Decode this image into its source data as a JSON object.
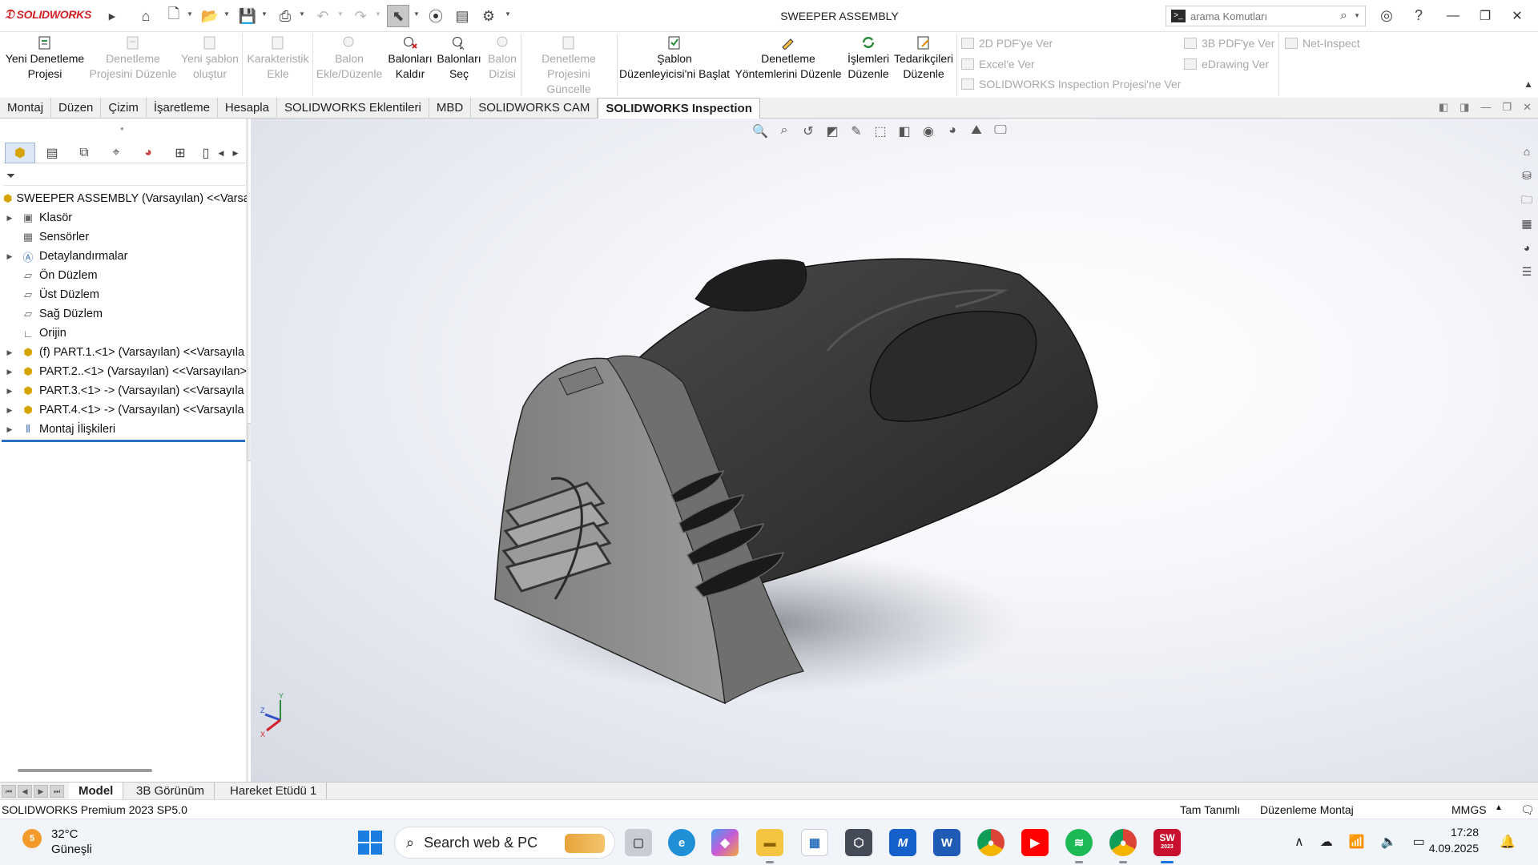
{
  "app": {
    "logo_text": "SOLIDWORKS",
    "document_title": "SWEEPER ASSEMBLY",
    "search_placeholder": "arama Komutları"
  },
  "ribbon": {
    "large_buttons": [
      {
        "label_1": "Yeni Denetleme",
        "label_2": "Projesi",
        "enabled": true,
        "icon": "new-inspection-project-icon"
      },
      {
        "label_1": "Denetleme",
        "label_2": "Projesini Düzenle",
        "enabled": false,
        "icon": "edit-inspection-project-icon"
      },
      {
        "label_1": "Yeni şablon",
        "label_2": "oluştur",
        "enabled": false,
        "icon": "new-template-icon"
      },
      {
        "label_1": "Karakteristik",
        "label_2": "Ekle",
        "enabled": false,
        "icon": "add-characteristic-icon"
      },
      {
        "label_1": "Balon",
        "label_2": "Ekle/Düzenle",
        "enabled": false,
        "icon": "balloon-edit-icon"
      },
      {
        "label_1": "Balonları",
        "label_2": "Kaldır",
        "enabled": true,
        "icon": "remove-balloons-icon"
      },
      {
        "label_1": "Balonları",
        "label_2": "Seç",
        "enabled": true,
        "icon": "select-balloons-icon"
      },
      {
        "label_1": "Balon",
        "label_2": "Dizisi",
        "enabled": false,
        "icon": "balloon-sequence-icon"
      },
      {
        "label_1": "Denetleme",
        "label_2": "Projesini Güncelle",
        "enabled": false,
        "icon": "update-inspection-project-icon"
      },
      {
        "label_1": "Şablon",
        "label_2": "Düzenleyicisi'ni Başlat",
        "enabled": true,
        "icon": "template-editor-icon"
      },
      {
        "label_1": "Denetleme",
        "label_2": "Yöntemlerini Düzenle",
        "enabled": true,
        "icon": "edit-inspection-methods-icon"
      },
      {
        "label_1": "İşlemleri",
        "label_2": "Düzenle",
        "enabled": true,
        "icon": "edit-operations-icon"
      },
      {
        "label_1": "Tedarikçileri",
        "label_2": "Düzenle",
        "enabled": true,
        "icon": "edit-vendors-icon"
      }
    ],
    "small_buttons": [
      {
        "label": "2D PDF'ye Ver",
        "enabled": false
      },
      {
        "label": "Excel'e Ver",
        "enabled": false
      },
      {
        "label": "SOLIDWORKS Inspection Projesi'ne Ver",
        "enabled": false
      },
      {
        "label": "3B PDF'ye Ver",
        "enabled": false
      },
      {
        "label": "eDrawing Ver",
        "enabled": false
      },
      {
        "label": "Net-Inspect",
        "enabled": false
      }
    ]
  },
  "tabs": [
    "Montaj",
    "Düzen",
    "Çizim",
    "İşaretleme",
    "Hesapla",
    "SOLIDWORKS Eklentileri",
    "MBD",
    "SOLIDWORKS CAM",
    "SOLIDWORKS Inspection"
  ],
  "active_tab": "SOLIDWORKS Inspection",
  "tree": {
    "root": "SWEEPER ASSEMBLY  (Varsayılan) <<Varsa",
    "items": [
      {
        "label": "Klasör",
        "expandable": true,
        "icon": "folder-icon"
      },
      {
        "label": "Sensörler",
        "expandable": false,
        "icon": "sensor-icon"
      },
      {
        "label": "Detaylandırmalar",
        "expandable": true,
        "icon": "annotations-icon"
      },
      {
        "label": "Ön Düzlem",
        "expandable": false,
        "icon": "plane-icon"
      },
      {
        "label": "Üst Düzlem",
        "expandable": false,
        "icon": "plane-icon"
      },
      {
        "label": "Sağ Düzlem",
        "expandable": false,
        "icon": "plane-icon"
      },
      {
        "label": "Orijin",
        "expandable": false,
        "icon": "origin-icon"
      },
      {
        "label": "(f) PART.1.<1> (Varsayılan) <<Varsayıla",
        "expandable": true,
        "icon": "part-icon"
      },
      {
        "label": "PART.2..<1> (Varsayılan) <<Varsayılan>",
        "expandable": true,
        "icon": "part-icon"
      },
      {
        "label": "PART.3.<1> -> (Varsayılan) <<Varsayıla",
        "expandable": true,
        "icon": "part-icon"
      },
      {
        "label": "PART.4.<1> -> (Varsayılan) <<Varsayıla",
        "expandable": true,
        "icon": "part-icon"
      },
      {
        "label": "Montaj İlişkileri",
        "expandable": true,
        "icon": "mates-icon"
      }
    ]
  },
  "triad": {
    "x": "X",
    "y": "Y",
    "z": "Z"
  },
  "sheet_tabs": [
    "Model",
    "3B Görünüm",
    "Hareket Etüdü 1"
  ],
  "active_sheet_tab": "Model",
  "status": {
    "version": "SOLIDWORKS Premium 2023 SP5.0",
    "definition": "Tam Tanımlı",
    "mode": "Düzenleme Montaj",
    "units": "MMGS",
    "units_caret": "▲"
  },
  "taskbar": {
    "weather_badge": "5",
    "weather_temp": "32°C",
    "weather_desc": "Güneşli",
    "search_label": "Search web & PC",
    "clock_time": "17:28",
    "clock_date": "4.09.2025",
    "solidworks_year": "2023"
  },
  "colors": {
    "accent": "#2a6fc0",
    "solidworks_red": "#d32027",
    "model_body": "#3a3a3a",
    "model_face": "#8c8c8c"
  }
}
